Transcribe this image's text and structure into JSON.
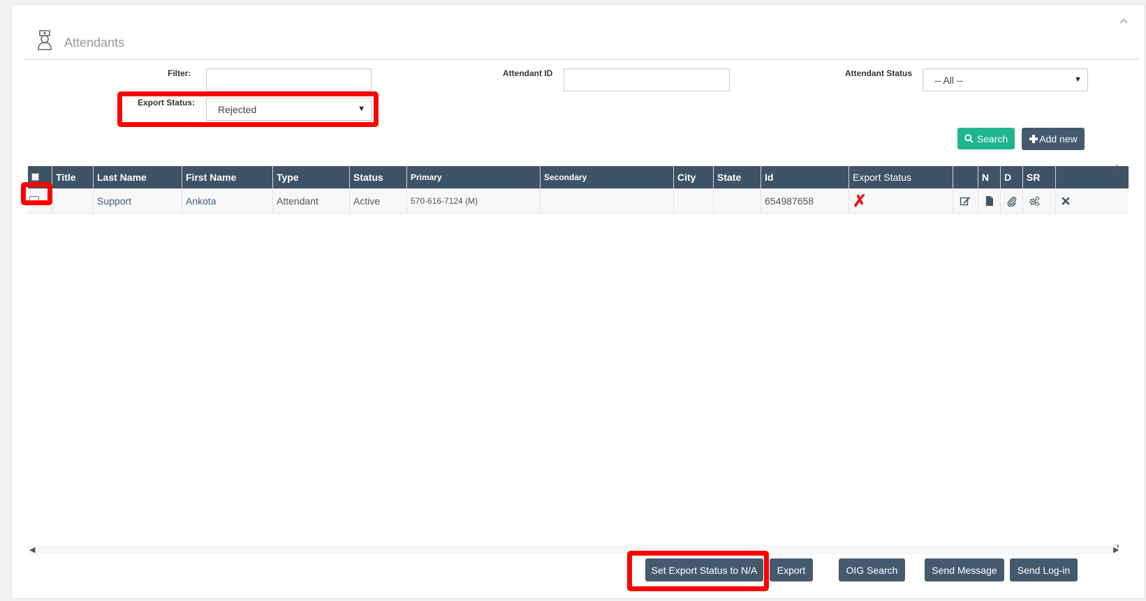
{
  "page": {
    "title": "Attendants"
  },
  "filters": {
    "filter_label": "Filter:",
    "filter_value": "",
    "attendant_id_label": "Attendant ID",
    "attendant_id_value": "",
    "attendant_status_label": "Attendant Status",
    "attendant_status_value": "-- All --",
    "export_status_label": "Export Status:",
    "export_status_value": "Rejected"
  },
  "toolbar": {
    "search_label": "Search",
    "add_new_label": "Add new"
  },
  "table": {
    "columns": [
      "Title",
      "Last Name",
      "First Name",
      "Type",
      "Status",
      "Primary",
      "Secondary",
      "City",
      "State",
      "Id",
      "Export Status",
      "",
      "N",
      "D",
      "SR",
      ""
    ],
    "rows": [
      {
        "title": "",
        "last_name": "Support",
        "first_name": "Ankota",
        "type": "Attendant",
        "status": "Active",
        "primary": "570-616-7124 (M)",
        "secondary": "",
        "city": "",
        "state": "",
        "id": "654987658",
        "export_status_mark": "✗",
        "checked": false
      }
    ]
  },
  "footer": {
    "set_export_label": "Set Export Status to N/A",
    "export_label": "Export",
    "oig_label": "OIG Search",
    "send_message_label": "Send Message",
    "send_login_label": "Send Log-in"
  },
  "colors": {
    "header": "#3f5366",
    "teal": "#1fb58f",
    "button": "#465a6e",
    "highlight": "#ff0000",
    "rejected": "#e8141a"
  }
}
